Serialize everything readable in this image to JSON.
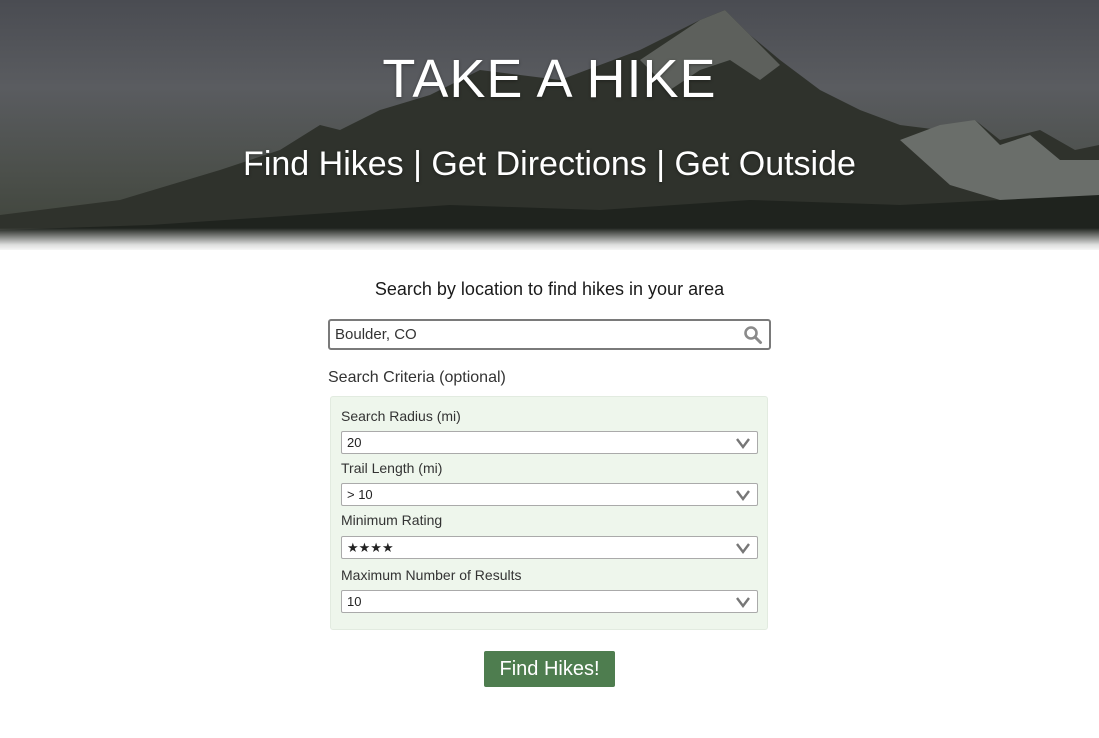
{
  "hero": {
    "title": "TAKE A HIKE",
    "subtitle": "Find Hikes | Get Directions | Get Outside"
  },
  "search": {
    "prompt": "Search by location to find hikes in your area",
    "value": "Boulder, CO",
    "icon": "search-icon"
  },
  "criteria": {
    "heading": "Search Criteria (optional)",
    "fields": [
      {
        "label": "Search Radius (mi)",
        "value": "20"
      },
      {
        "label": "Trail Length (mi)",
        "value": "> 10"
      },
      {
        "label": "Minimum Rating",
        "value": "★★★★"
      },
      {
        "label": "Maximum Number of Results",
        "value": "10"
      }
    ]
  },
  "button": {
    "label": "Find Hikes!"
  },
  "colors": {
    "accent": "#4e7d4f",
    "panel": "#eef6ec"
  }
}
